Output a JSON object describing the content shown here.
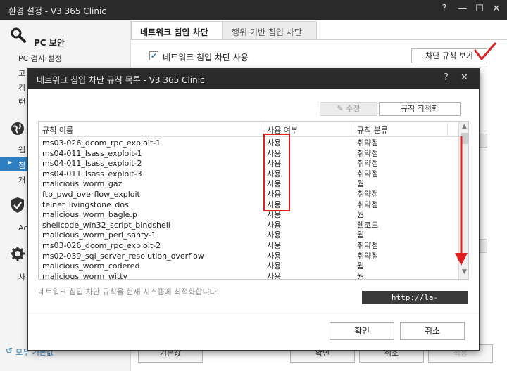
{
  "background_window": {
    "title": "환경 설정 - V3 365 Clinic",
    "controls": {
      "help": "?",
      "minimize": "—",
      "maximize": "☐",
      "close": "✕"
    },
    "sidebar": {
      "heading": "PC 보안",
      "items": [
        "PC 검사 설정",
        "고",
        "검",
        "랜",
        "웹",
        "침",
        "개",
        "Ac",
        "사"
      ],
      "footer": "모두 기본값"
    },
    "tabs": [
      "네트워크 침입 차단",
      "행위 기반 침입 차단"
    ],
    "enable_checkbox_label": "네트워크 침입 차단 사용",
    "view_rules_button": "차단 규칙 보기",
    "footer_buttons": [
      "기본값",
      "확인",
      "취소",
      "적용"
    ]
  },
  "dialog": {
    "title": "네트워크 침입 차단 규칙 목록 - V3 365 Clinic",
    "controls": {
      "help": "?",
      "close": "✕"
    },
    "edit_button": "✎ 수정",
    "optimize_button": "규칙 최적화",
    "columns": [
      "규칙 이름",
      "사용 여부",
      "규칙 분류"
    ],
    "rows": [
      [
        "ms03-026_dcom_rpc_exploit-1",
        "사용",
        "취약점"
      ],
      [
        "ms04-011_lsass_exploit-1",
        "사용",
        "취약점"
      ],
      [
        "ms04-011_lsass_exploit-2",
        "사용",
        "취약점"
      ],
      [
        "ms04-011_lsass_exploit-3",
        "사용",
        "취약점"
      ],
      [
        "malicious_worm_gaz",
        "사용",
        "웜"
      ],
      [
        "ftp_pwd_overflow_exploit",
        "사용",
        "취약점"
      ],
      [
        "telnet_livingstone_dos",
        "사용",
        "취약점"
      ],
      [
        "malicious_worm_bagle.p",
        "사용",
        "웜"
      ],
      [
        "shellcode_win32_script_bindshell",
        "사용",
        "쉘코드"
      ],
      [
        "malicious_worm_perl_santy-1",
        "사용",
        "웜"
      ],
      [
        "ms03-026_dcom_rpc_exploit-2",
        "사용",
        "취약점"
      ],
      [
        "ms02-039_sql_server_resolution_overflow",
        "사용",
        "취약점"
      ],
      [
        "malicious_worm_codered",
        "사용",
        "웜"
      ],
      [
        "malicious_worm_witty",
        "사용",
        "웜"
      ]
    ],
    "status_text": "네트워크 침입 차단 규칙을 현재 시스템에 최적화합니다.",
    "watermark_url": "http://la-nube.tistory.com",
    "ok_button": "확인",
    "cancel_button": "취소"
  },
  "colors": {
    "titlebar": "#2a2a2a",
    "accent": "#2d7fc1",
    "annotation_red": "#e02020"
  }
}
